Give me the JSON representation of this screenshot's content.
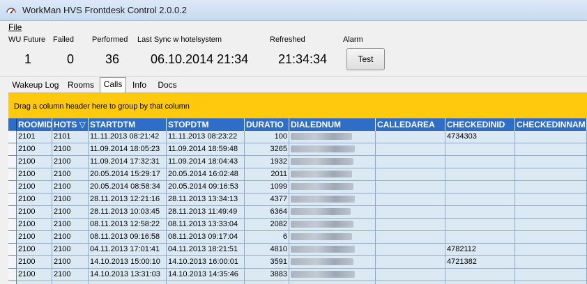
{
  "window": {
    "title": "WorkMan HVS Frontdesk Control 2.0.0.2"
  },
  "menu": {
    "file": "File"
  },
  "status": {
    "labels": [
      "WU Future",
      "Failed",
      "Performed",
      "Last Sync w hotelsystem",
      "Refreshed",
      "Alarm"
    ],
    "wu_future": "1",
    "failed": "0",
    "performed": "36",
    "last_sync": "06.10.2014 21:34",
    "refreshed": "21:34:34",
    "test_button": "Test"
  },
  "tabs": [
    "Wakeup Log",
    "Rooms",
    "Calls",
    "Info",
    "Docs"
  ],
  "active_tab": "Calls",
  "group_panel_text": "Drag a column header here to group by that column",
  "grid": {
    "columns": [
      "ROOMID",
      "HOTS",
      "STARTDTM",
      "STOPDTM",
      "DURATIO",
      "DIALEDNUM",
      "CALLEDAREA",
      "CHECKEDINID",
      "CHECKEDINNAM"
    ],
    "sort_glyph": "▽",
    "rows": [
      [
        "2101",
        "2101",
        "11.11.2013 08:21:42",
        "11.11.2013 08:23:22",
        "100",
        "",
        "",
        "4734303",
        ""
      ],
      [
        "2100",
        "2100",
        "11.09.2014 18:05:23",
        "11.09.2014 18:59:48",
        "3265",
        "",
        "",
        "",
        ""
      ],
      [
        "2100",
        "2100",
        "11.09.2014 17:32:31",
        "11.09.2014 18:04:43",
        "1932",
        "",
        "",
        "",
        ""
      ],
      [
        "2100",
        "2100",
        "20.05.2014 15:29:17",
        "20.05.2014 16:02:48",
        "2011",
        "",
        "",
        "",
        ""
      ],
      [
        "2100",
        "2100",
        "20.05.2014 08:58:34",
        "20.05.2014 09:16:53",
        "1099",
        "",
        "",
        "",
        ""
      ],
      [
        "2100",
        "2100",
        "28.11.2013 12:21:16",
        "28.11.2013 13:34:13",
        "4377",
        "",
        "",
        "",
        ""
      ],
      [
        "2100",
        "2100",
        "28.11.2013 10:03:45",
        "28.11.2013 11:49:49",
        "6364",
        "",
        "",
        "",
        ""
      ],
      [
        "2100",
        "2100",
        "08.11.2013 12:58:22",
        "08.11.2013 13:33:04",
        "2082",
        "",
        "",
        "",
        ""
      ],
      [
        "2100",
        "2100",
        "08.11.2013 09:16:58",
        "08.11.2013 09:17:04",
        "6",
        "",
        "",
        "",
        ""
      ],
      [
        "2100",
        "2100",
        "04.11.2013 17:01:41",
        "04.11.2013 18:21:51",
        "4810",
        "",
        "",
        "4782112",
        ""
      ],
      [
        "2100",
        "2100",
        "14.10.2013 15:00:10",
        "14.10.2013 16:00:01",
        "3591",
        "",
        "",
        "4721382",
        ""
      ],
      [
        "2100",
        "2100",
        "14.10.2013 13:31:03",
        "14.10.2013 14:35:46",
        "3883",
        "",
        "",
        "",
        ""
      ],
      [
        "",
        "",
        "",
        "",
        "",
        "",
        "",
        "",
        ""
      ]
    ]
  }
}
